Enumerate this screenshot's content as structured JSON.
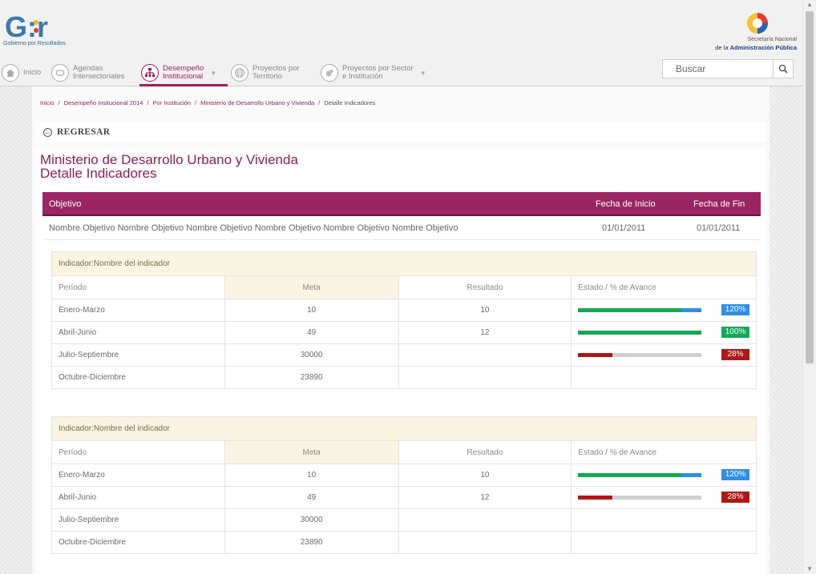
{
  "brand": {
    "logo_text": "G:r",
    "logo_caption": "Gobierno por Resultados",
    "sna_line1": "Secretaría Nacional",
    "sna_line2_prefix": "de la",
    "sna_line2_strong": "Administración Pública"
  },
  "nav": {
    "items": [
      {
        "label": "Inicio",
        "icon": "home-icon"
      },
      {
        "label": "Agendas\nIntersectoriales",
        "icon": "agenda-icon"
      },
      {
        "label": "Desempeño\nInstitucional",
        "icon": "org-chart-icon",
        "active": true
      },
      {
        "label": "Proyectos por\nTerritorio",
        "icon": "globe-icon"
      },
      {
        "label": "Proyectos por Sector\ne Institución",
        "icon": "sector-icon"
      }
    ],
    "search_placeholder": "Buscar"
  },
  "breadcrumb": [
    "Inicio",
    "Desempeño Insitucional 2014",
    "Por Institución",
    "Ministerio de Desarrollo Urbano y Vivienda",
    "Detalle Indicadores"
  ],
  "back_label": "REGRESAR",
  "title": {
    "line1": "Ministerio de Desarrollo Urbano y Vivienda",
    "line2": "Detalle Indicadores"
  },
  "objective": {
    "headers": {
      "objetivo": "Objetivo",
      "inicio": "Fecha de Inicio",
      "fin": "Fecha de Fin"
    },
    "name": "Nombre Objetivo Nombre Objetivo Nombre Objetivo Nombre Objetivo Nombre Objetivo Nombre Objetivo",
    "start": "01/01/2011",
    "end": "01/01/2011"
  },
  "colors": {
    "accent": "#9b2562",
    "green": "#12a956",
    "red": "#b01818",
    "blue": "#2f8ee8"
  },
  "indicators": [
    {
      "title": "Indicador:Nombre del indicador",
      "headers": {
        "periodo": "Período",
        "meta": "Meta",
        "resultado": "Resultado",
        "estado": "Estado / % de Avance"
      },
      "rows": [
        {
          "periodo": "Enero-Marzo",
          "meta": "10",
          "resultado": "10",
          "progress": 120,
          "badge": "120%",
          "status": "exceeded"
        },
        {
          "periodo": "Abril-Junio",
          "meta": "49",
          "resultado": "12",
          "progress": 100,
          "badge": "100%",
          "status": "complete"
        },
        {
          "periodo": "Julio-Septiembre",
          "meta": "30000",
          "resultado": "",
          "progress": 28,
          "badge": "28%",
          "status": "low"
        },
        {
          "periodo": "Octubre-Diciembre",
          "meta": "23890",
          "resultado": "",
          "progress": null,
          "badge": "",
          "status": ""
        }
      ]
    },
    {
      "title": "Indicador:Nombre del indicador",
      "headers": {
        "periodo": "Período",
        "meta": "Meta",
        "resultado": "Resultado",
        "estado": "Estado / % de Avance"
      },
      "rows": [
        {
          "periodo": "Enero-Marzo",
          "meta": "10",
          "resultado": "10",
          "progress": 120,
          "badge": "120%",
          "status": "exceeded"
        },
        {
          "periodo": "Abril-Junio",
          "meta": "49",
          "resultado": "12",
          "progress": 28,
          "badge": "28%",
          "status": "low"
        },
        {
          "periodo": "Julio-Septiembre",
          "meta": "30000",
          "resultado": "",
          "progress": null,
          "badge": "",
          "status": ""
        },
        {
          "periodo": "Octubre-Diciembre",
          "meta": "23890",
          "resultado": "",
          "progress": null,
          "badge": "",
          "status": ""
        }
      ]
    }
  ]
}
